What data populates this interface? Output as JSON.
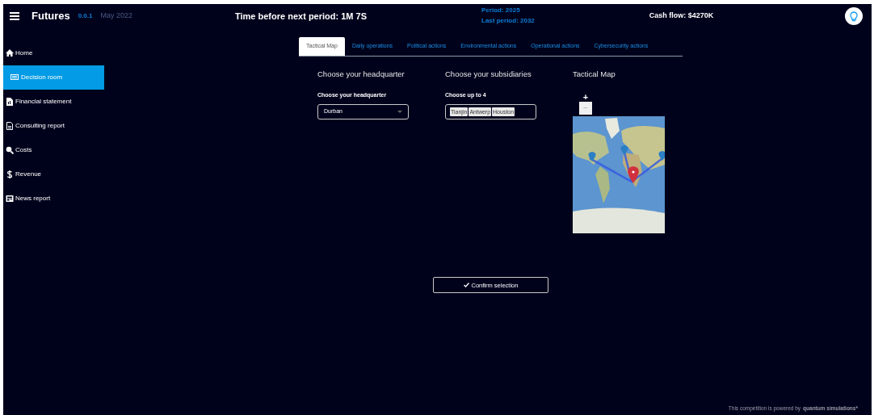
{
  "header": {
    "app_name": "Futures",
    "version": "0.0.1",
    "date": "May 2022",
    "timer": "Time before next period: 1M 7S",
    "period": "Period: 2025",
    "last_period": "Last period: 2032",
    "cash_flow": "Cash flow: $4270K"
  },
  "sidebar": {
    "items": [
      {
        "label": "Home",
        "kind": "home",
        "selected": false
      },
      {
        "label": "Decision room",
        "kind": "keyboard",
        "selected": true
      },
      {
        "label": "Financial statement",
        "kind": "statement",
        "selected": false
      },
      {
        "label": "Consulting report",
        "kind": "report",
        "selected": false
      },
      {
        "label": "Costs",
        "kind": "search",
        "selected": false
      },
      {
        "label": "Revenue",
        "kind": "dollar",
        "selected": false
      },
      {
        "label": "News report",
        "kind": "newspaper",
        "selected": false
      }
    ]
  },
  "tabs": [
    {
      "label": "Tactical Map",
      "selected": true
    },
    {
      "label": "Daily operations",
      "selected": false
    },
    {
      "label": "Political actions",
      "selected": false
    },
    {
      "label": "Environmental actions",
      "selected": false
    },
    {
      "label": "Operational actions",
      "selected": false
    },
    {
      "label": "Cybersecurity actions",
      "selected": false
    }
  ],
  "headquarter": {
    "heading": "Choose your headquarter",
    "label": "Choose your headquarter",
    "value": "Durban"
  },
  "subsidiaries": {
    "heading": "Choose your subsidiaries",
    "label": "Choose up to 4",
    "chips": [
      "Tianjin",
      "Antwerp",
      "Houston"
    ]
  },
  "map": {
    "heading": "Tactical Map",
    "zoom_in": "+",
    "zoom_out": "−"
  },
  "confirm_button": "Confirm selection",
  "footer": {
    "text": "This competition is powered by",
    "brand": "quantum simulations*"
  }
}
